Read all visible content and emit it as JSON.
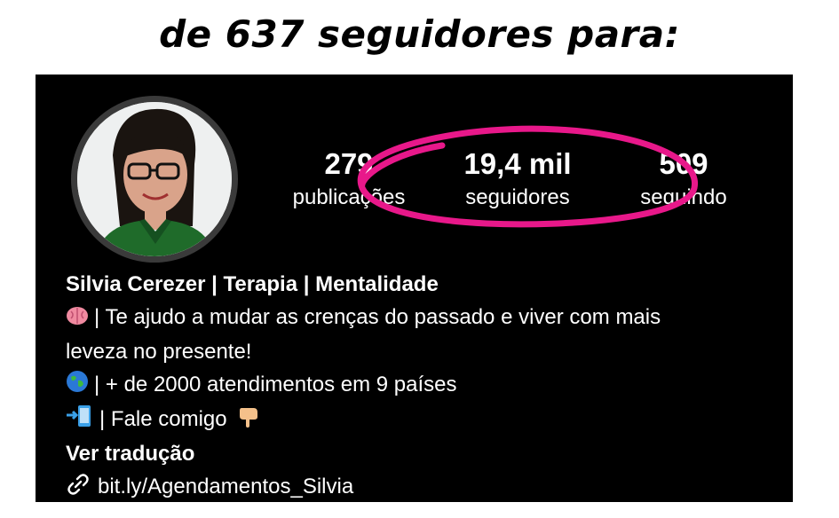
{
  "headline": "de 637 seguidores  para:",
  "profile": {
    "stats": [
      {
        "value": "279",
        "label": "publicações"
      },
      {
        "value": "19,4 mil",
        "label": "seguidores"
      },
      {
        "value": "509",
        "label": "seguindo"
      }
    ],
    "name": "Silvia Cerezer | Terapia | Mentalidade",
    "bio": [
      {
        "icon": "brain-icon",
        "text": "| Te ajudo a mudar as crenças do passado e viver com mais"
      },
      {
        "icon": "",
        "text": "leveza no presente!"
      },
      {
        "icon": "globe-icon",
        "text": "| + de 2000 atendimentos em 9 países"
      },
      {
        "icon": "phone-arrow-icon",
        "text": "| Fale comigo"
      }
    ],
    "translate_label": "Ver tradução",
    "link": "bit.ly/Agendamentos_Silvia",
    "highlight_color": "#e8188a"
  }
}
